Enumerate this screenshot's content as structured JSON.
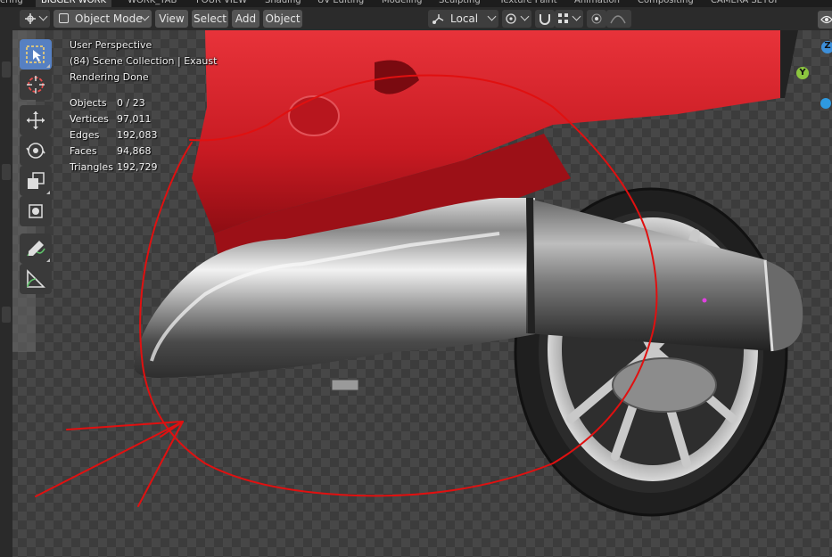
{
  "workspace_tabs": [
    {
      "label": "ering",
      "active": false
    },
    {
      "label": "BIGGER WORK",
      "active": true
    },
    {
      "label": "WORK_TAB",
      "active": false
    },
    {
      "label": "FOUR VIEW",
      "active": false
    },
    {
      "label": "Shading",
      "active": false
    },
    {
      "label": "UV Editing",
      "active": false
    },
    {
      "label": "Modeling",
      "active": false
    },
    {
      "label": "Sculpting",
      "active": false
    },
    {
      "label": "Texture Paint",
      "active": false
    },
    {
      "label": "Animation",
      "active": false
    },
    {
      "label": "Compositing",
      "active": false
    },
    {
      "label": "CAMERA SETUP",
      "active": false
    }
  ],
  "header": {
    "mode": "Object Mode",
    "menus": [
      "View",
      "Select",
      "Add",
      "Object"
    ],
    "transform_orientation": "Local"
  },
  "overlay": {
    "perspective": "User Perspective",
    "collection": "(84) Scene Collection | Exaust",
    "render_status": "Rendering Done",
    "stats": [
      {
        "label": "Objects",
        "value": "0 / 23"
      },
      {
        "label": "Vertices",
        "value": "97,011"
      },
      {
        "label": "Edges",
        "value": "192,083"
      },
      {
        "label": "Faces",
        "value": "94,868"
      },
      {
        "label": "Triangles",
        "value": "192,729"
      }
    ]
  },
  "gizmo": {
    "y_label": "Y",
    "z_label": "Z"
  },
  "colors": {
    "accent_active_tool": "#5680c2",
    "annotation_stroke": "#e01010",
    "body_red": "#d8202a",
    "axis_y": "#8cc63f",
    "axis_z": "#3d8fd9"
  }
}
